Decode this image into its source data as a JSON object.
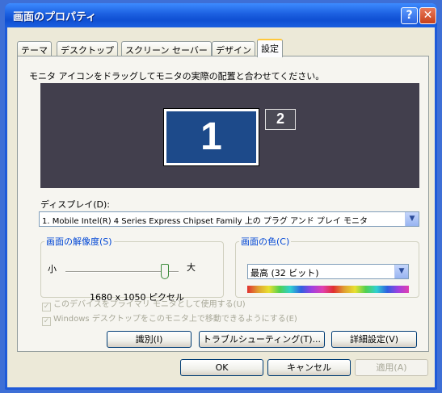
{
  "window": {
    "title": "画面のプロパティ",
    "help_glyph": "?",
    "close_glyph": "✕"
  },
  "tabs": [
    {
      "label": "テーマ",
      "active": false
    },
    {
      "label": "デスクトップ",
      "active": false
    },
    {
      "label": "スクリーン セーバー",
      "active": false
    },
    {
      "label": "デザイン",
      "active": false
    },
    {
      "label": "設定",
      "active": true
    }
  ],
  "settings": {
    "instruction": "モニタ アイコンをドラッグしてモニタの実際の配置と合わせてください。",
    "monitors": [
      {
        "number": "1",
        "selected": true
      },
      {
        "number": "2",
        "selected": false
      }
    ],
    "display_label": "ディスプレイ(D):",
    "display_value": "1. Mobile Intel(R) 4 Series Express Chipset Family 上の プラグ アンド プレイ モニタ",
    "resolution": {
      "legend": "画面の解像度(S)",
      "small_label": "小",
      "large_label": "大",
      "value_text": "1680 x 1050 ピクセル",
      "slider_fraction": 0.85
    },
    "color": {
      "legend": "画面の色(C)",
      "value": "最高 (32 ビット)"
    },
    "checkboxes": [
      {
        "label": "このデバイスをプライマリ モニタとして使用する(U)",
        "checked": true,
        "enabled": false
      },
      {
        "label": "Windows デスクトップをこのモニタ上で移動できるようにする(E)",
        "checked": true,
        "enabled": false
      }
    ],
    "buttons": {
      "identify": "識別(I)",
      "troubleshoot": "トラブルシューティング(T)...",
      "advanced": "詳細設定(V)"
    }
  },
  "dialog_buttons": {
    "ok": "OK",
    "cancel": "キャンセル",
    "apply": "適用(A)",
    "apply_enabled": false
  },
  "colors": {
    "title_bar": "#1b5fe0",
    "dialog_bg": "#ece9d8",
    "monitor_area": "#423f4d",
    "monitor_selected": "#1d4a8a",
    "group_legend": "#0046d5"
  },
  "icons": {
    "dropdown_arrow": "chevron-down-icon",
    "check": "checkmark-icon"
  }
}
